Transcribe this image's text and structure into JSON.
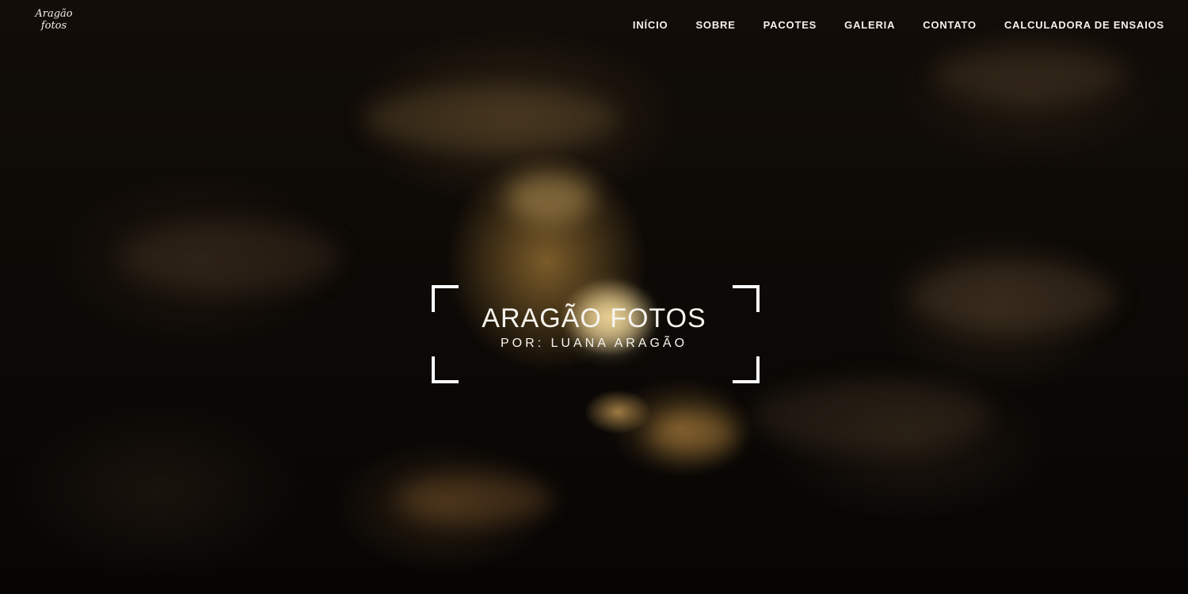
{
  "logo": {
    "line1": "Aragão",
    "line2": "fotos"
  },
  "nav": {
    "items": [
      {
        "label": "INÍCIO"
      },
      {
        "label": "SOBRE"
      },
      {
        "label": "PACOTES"
      },
      {
        "label": "GALERIA"
      },
      {
        "label": "CONTATO"
      },
      {
        "label": "CALCULADORA DE ENSAIOS"
      }
    ]
  },
  "hero": {
    "title": "ARAGÃO FOTOS",
    "subtitle": "POR: LUANA ARAGÃO"
  },
  "colors": {
    "text": "#f4f1ec",
    "frame": "#ffffff",
    "background": "#0b0805",
    "accent_glow": "#d6a046"
  }
}
